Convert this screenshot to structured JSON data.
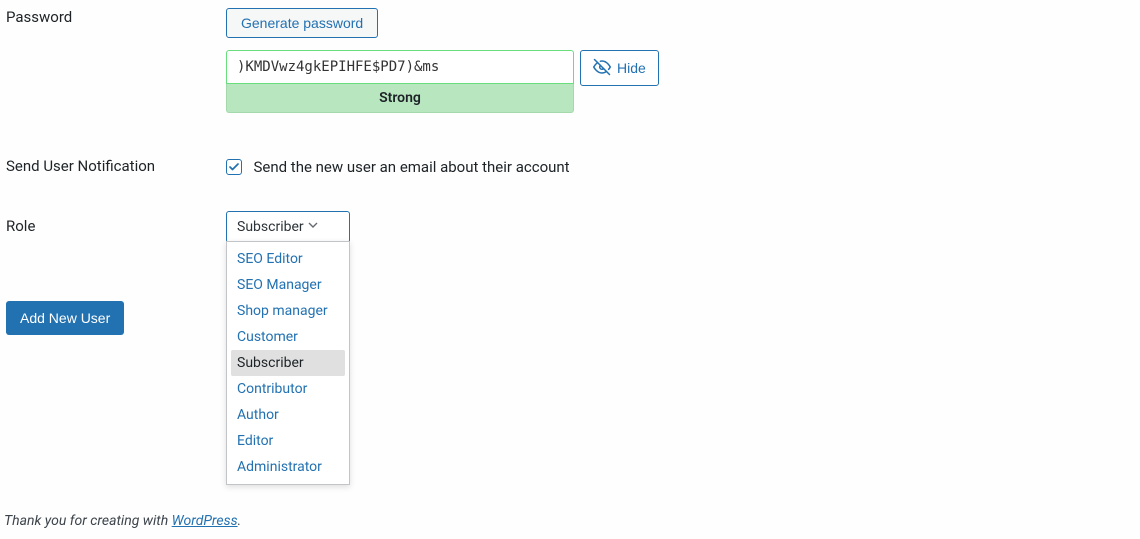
{
  "password": {
    "label": "Password",
    "generate_button": "Generate password",
    "value": ")KMDVwz4gkEPIHFE$PD7)&ms",
    "strength": "Strong",
    "hide_button": "Hide"
  },
  "notification": {
    "label": "Send User Notification",
    "text": "Send the new user an email about their account",
    "checked": true
  },
  "role": {
    "label": "Role",
    "selected": "Subscriber",
    "options": [
      "SEO Editor",
      "SEO Manager",
      "Shop manager",
      "Customer",
      "Subscriber",
      "Contributor",
      "Author",
      "Editor",
      "Administrator"
    ]
  },
  "submit_label": "Add New User",
  "footer": {
    "prefix": "Thank you for creating with ",
    "link": "WordPress",
    "suffix": "."
  }
}
